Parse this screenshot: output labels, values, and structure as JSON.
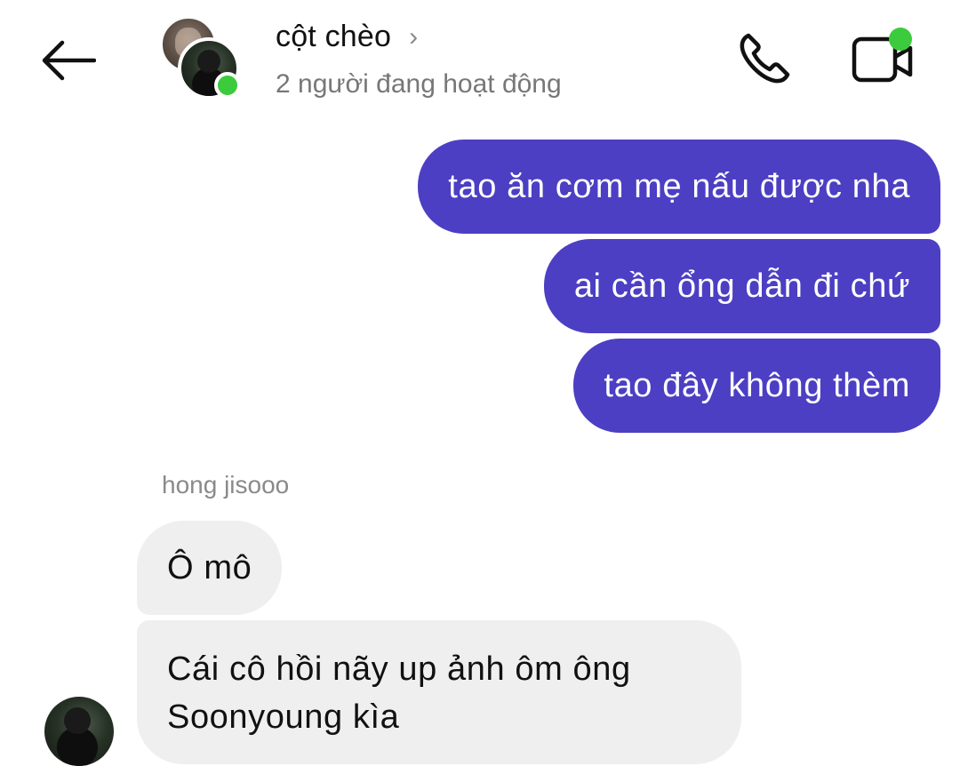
{
  "header": {
    "title": "cột chèo",
    "status": "2 người đang hoạt động",
    "chevron": "›"
  },
  "colors": {
    "outgoing_bubble": "#4c3fc3",
    "incoming_bubble": "#efefef",
    "online": "#3ccb3c"
  },
  "icons": {
    "back": "back-arrow-icon",
    "call": "phone-icon",
    "video": "video-camera-icon"
  },
  "messages": {
    "outgoing": [
      "tao ăn cơm mẹ nấu được nha",
      "ai cần ổng dẫn đi chứ",
      "tao đây không thèm"
    ],
    "incoming_sender": "hong jisooo",
    "incoming": [
      "Ô mô",
      "Cái cô hồi nãy up ảnh ôm ông Soonyoung kìa"
    ]
  }
}
